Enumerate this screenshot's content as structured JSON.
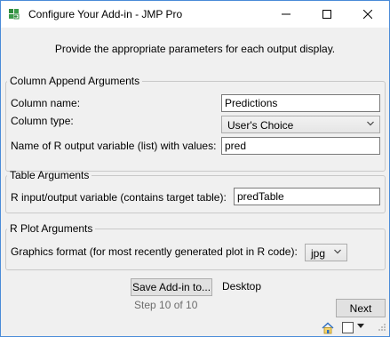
{
  "window": {
    "title": "Configure Your Add-in - JMP Pro",
    "app_icon": "jmp-add-in-icon",
    "controls": [
      "minimize-icon",
      "maximize-icon",
      "close-icon"
    ]
  },
  "instructions": "Provide the appropriate parameters for each output display.",
  "column_append": {
    "legend": "Column Append Arguments",
    "column_name_label": "Column name:",
    "column_name_value": "Predictions",
    "column_type_label": "Column type:",
    "column_type_value": "User's Choice",
    "r_output_label": "Name of R output variable (list) with values:",
    "r_output_value": "pred"
  },
  "table_args": {
    "legend": "Table Arguments",
    "r_io_label": "R input/output variable (contains target table):",
    "r_io_value": "predTable"
  },
  "r_plot": {
    "legend": "R Plot Arguments",
    "graphics_label": "Graphics format (for most recently generated plot in R code):",
    "graphics_value": "jpg"
  },
  "footer": {
    "save_button": "Save Add-in to...",
    "save_location": "Desktop",
    "step_text": "Step 10 of 10",
    "next_button": "Next"
  },
  "statusbar": {
    "icons": [
      "home-icon",
      "checkbox-icon",
      "dropdown-caret-icon",
      "resize-grip-icon"
    ]
  },
  "colors": {
    "window_border": "#4a8bd8",
    "background": "#f0f0f0",
    "group_border": "#c9c9c9",
    "input_border": "#7a7a7a"
  }
}
